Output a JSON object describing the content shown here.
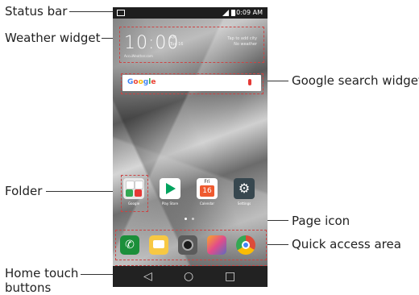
{
  "annotations": {
    "status_bar": "Status bar",
    "weather_widget": "Weather widget",
    "google_search_widget": "Google search widget",
    "folder": "Folder",
    "page_icon": "Page icon",
    "quick_access_area": "Quick access area",
    "home_touch_buttons_line1": "Home touch",
    "home_touch_buttons_line2": "buttons"
  },
  "phone": {
    "status": {
      "time": "10:09 AM",
      "notification_icon": "image-icon",
      "signal_icon": "signal-icon",
      "battery_icon": "battery-icon"
    },
    "weather": {
      "time": "10:00",
      "ampm": "AM",
      "date": "Tue 16",
      "tap": "Tap to add city",
      "no_weather": "No weather",
      "source": "AccuWeather.com"
    },
    "search": {
      "logo": "Google",
      "mic_icon": "mic-icon"
    },
    "apps": [
      {
        "label": "Google",
        "icon": "folder-icon"
      },
      {
        "label": "Play Store",
        "icon": "play-store-icon"
      },
      {
        "label": "Calendar",
        "icon": "calendar-icon",
        "day": "Fri",
        "date": "16"
      },
      {
        "label": "Settings",
        "icon": "gear-icon"
      }
    ],
    "quick_access": [
      {
        "icon": "phone-icon",
        "color": "#1b8f3a"
      },
      {
        "icon": "messaging-icon",
        "color": "#f7c843"
      },
      {
        "icon": "camera-icon",
        "color": "#5b5b5b"
      },
      {
        "icon": "gallery-icon",
        "color": "#e24c8a"
      },
      {
        "icon": "chrome-icon",
        "color": "#dd4b39"
      }
    ],
    "nav": {
      "back_icon": "back-icon",
      "home_icon": "home-icon",
      "recents_icon": "recents-icon"
    }
  }
}
